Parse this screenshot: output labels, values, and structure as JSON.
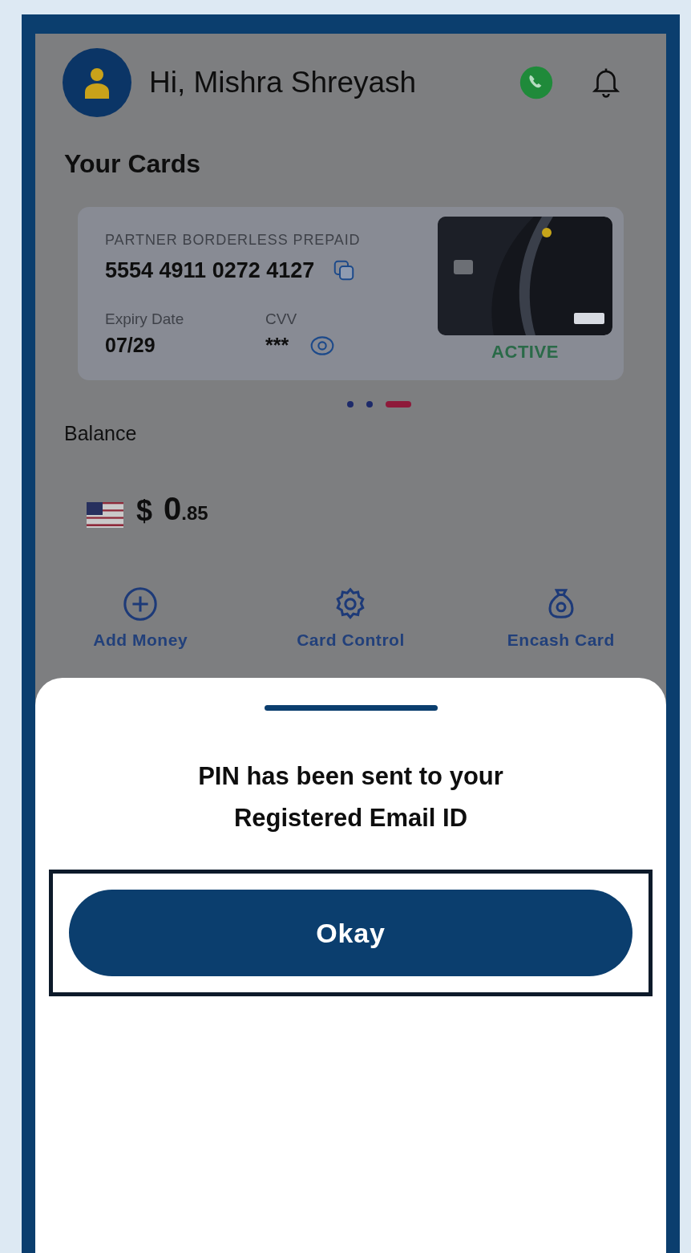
{
  "header": {
    "greeting": "Hi, Mishra Shreyash"
  },
  "cards_section": {
    "title": "Your Cards",
    "card": {
      "product": "PARTNER BORDERLESS PREPAID",
      "number": "5554 4911 0272 4127",
      "expiry_label": "Expiry Date",
      "expiry": "07/29",
      "cvv_label": "CVV",
      "cvv": "***",
      "status": "ACTIVE"
    },
    "indicators": [
      {
        "selected": false
      },
      {
        "selected": false
      },
      {
        "selected": true
      }
    ]
  },
  "balance": {
    "label": "Balance",
    "currency": "$",
    "whole": "0",
    "fraction": ".85"
  },
  "actions": [
    {
      "kind": "add",
      "label": "Add Money"
    },
    {
      "kind": "settings",
      "label": "Card Control"
    },
    {
      "kind": "bag",
      "label": "Encash Card"
    }
  ],
  "sheet": {
    "message": "PIN has been sent to your Registered Email ID",
    "button": "Okay",
    "highlighted": true
  }
}
